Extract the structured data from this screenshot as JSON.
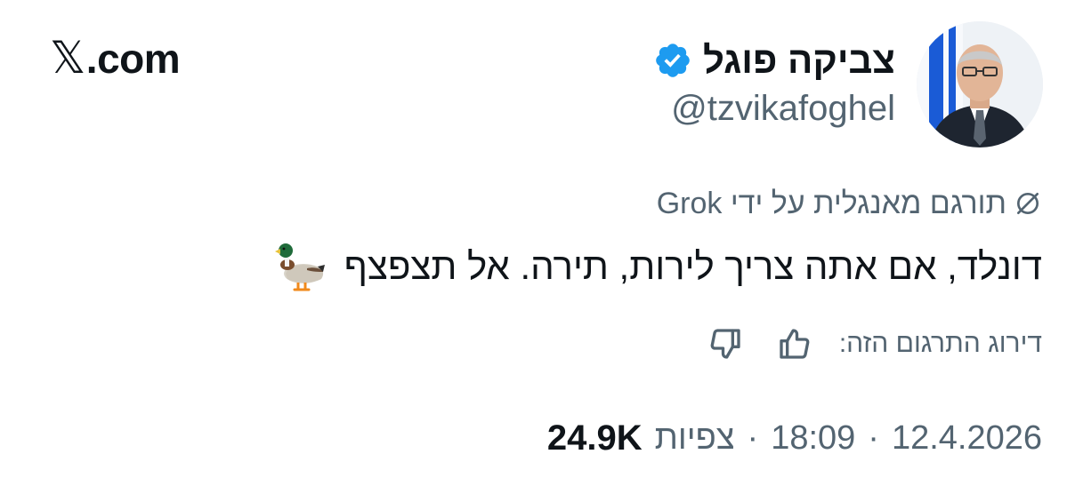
{
  "brand": {
    "x_mark": "𝕏",
    "suffix": ".com"
  },
  "author": {
    "display_name": "צביקה פוגל",
    "handle": "@tzvikafoghel",
    "verified": true
  },
  "translation": {
    "label": "תורגם מאנגלית על ידי Grok",
    "icon": "translate-icon"
  },
  "tweet": {
    "text": "דונלד, אם אתה צריך לירות, תירה. אל תצפצף",
    "emoji": "duck-emoji"
  },
  "rating": {
    "label": "דירוג התרגום הזה:",
    "up_icon": "thumbs-up-icon",
    "down_icon": "thumbs-down-icon"
  },
  "meta": {
    "date": "12.4.2026",
    "sep1": "·",
    "time": "18:09",
    "sep2": "·",
    "views_count": "24.9K",
    "views_label": "צפיות"
  },
  "colors": {
    "text": "#0f1419",
    "secondary": "#536471",
    "verified_blue": "#1d9bf0"
  }
}
